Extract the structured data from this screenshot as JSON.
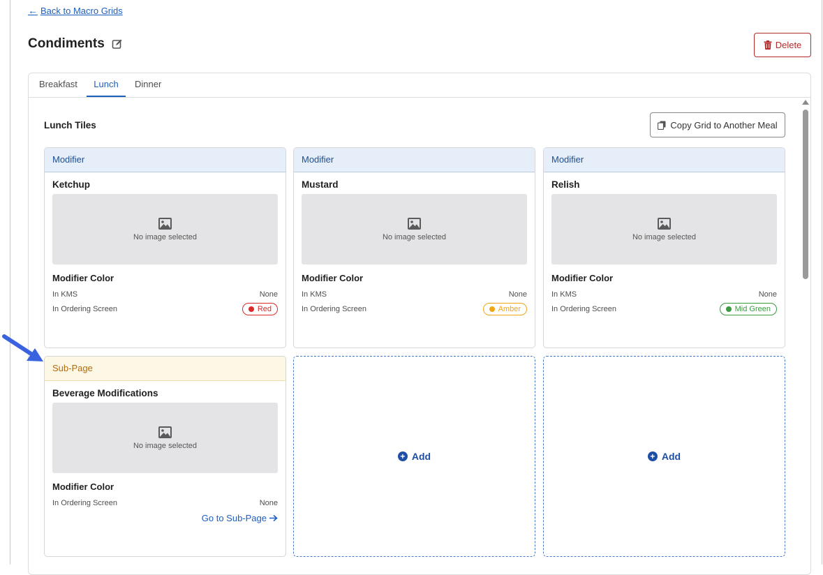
{
  "back_link": {
    "label": "Back to Macro Grids"
  },
  "page": {
    "title": "Condiments"
  },
  "actions": {
    "delete_label": "Delete",
    "copy_label": "Copy Grid to Another Meal"
  },
  "tabs": [
    {
      "label": "Breakfast",
      "active": false
    },
    {
      "label": "Lunch",
      "active": true
    },
    {
      "label": "Dinner",
      "active": false
    }
  ],
  "section": {
    "title": "Lunch Tiles"
  },
  "tiles": [
    {
      "type": "Modifier",
      "name": "Ketchup",
      "image_text": "No image selected",
      "color_title": "Modifier Color",
      "kms_label": "In KMS",
      "kms_value": "None",
      "ordering_label": "In Ordering Screen",
      "ordering_value": "Red",
      "ordering_color": "#d92b2b"
    },
    {
      "type": "Modifier",
      "name": "Mustard",
      "image_text": "No image selected",
      "color_title": "Modifier Color",
      "kms_label": "In KMS",
      "kms_value": "None",
      "ordering_label": "In Ordering Screen",
      "ordering_value": "Amber",
      "ordering_color": "#f2a516"
    },
    {
      "type": "Modifier",
      "name": "Relish",
      "image_text": "No image selected",
      "color_title": "Modifier Color",
      "kms_label": "In KMS",
      "kms_value": "None",
      "ordering_label": "In Ordering Screen",
      "ordering_value": "Mid Green",
      "ordering_color": "#3a9a3f"
    },
    {
      "type": "Sub-Page",
      "name": "Beverage Modifications",
      "image_text": "No image selected",
      "color_title": "Modifier Color",
      "ordering_label": "In Ordering Screen",
      "ordering_value": "None",
      "link_label": "Go to Sub-Page"
    }
  ],
  "add_tiles": [
    {
      "label": "Add"
    },
    {
      "label": "Add"
    }
  ],
  "colors": {
    "accent": "#1d5fbf",
    "danger": "#b42b2b",
    "subpage": "#b56a0e",
    "annotation": "#3b63e0"
  }
}
